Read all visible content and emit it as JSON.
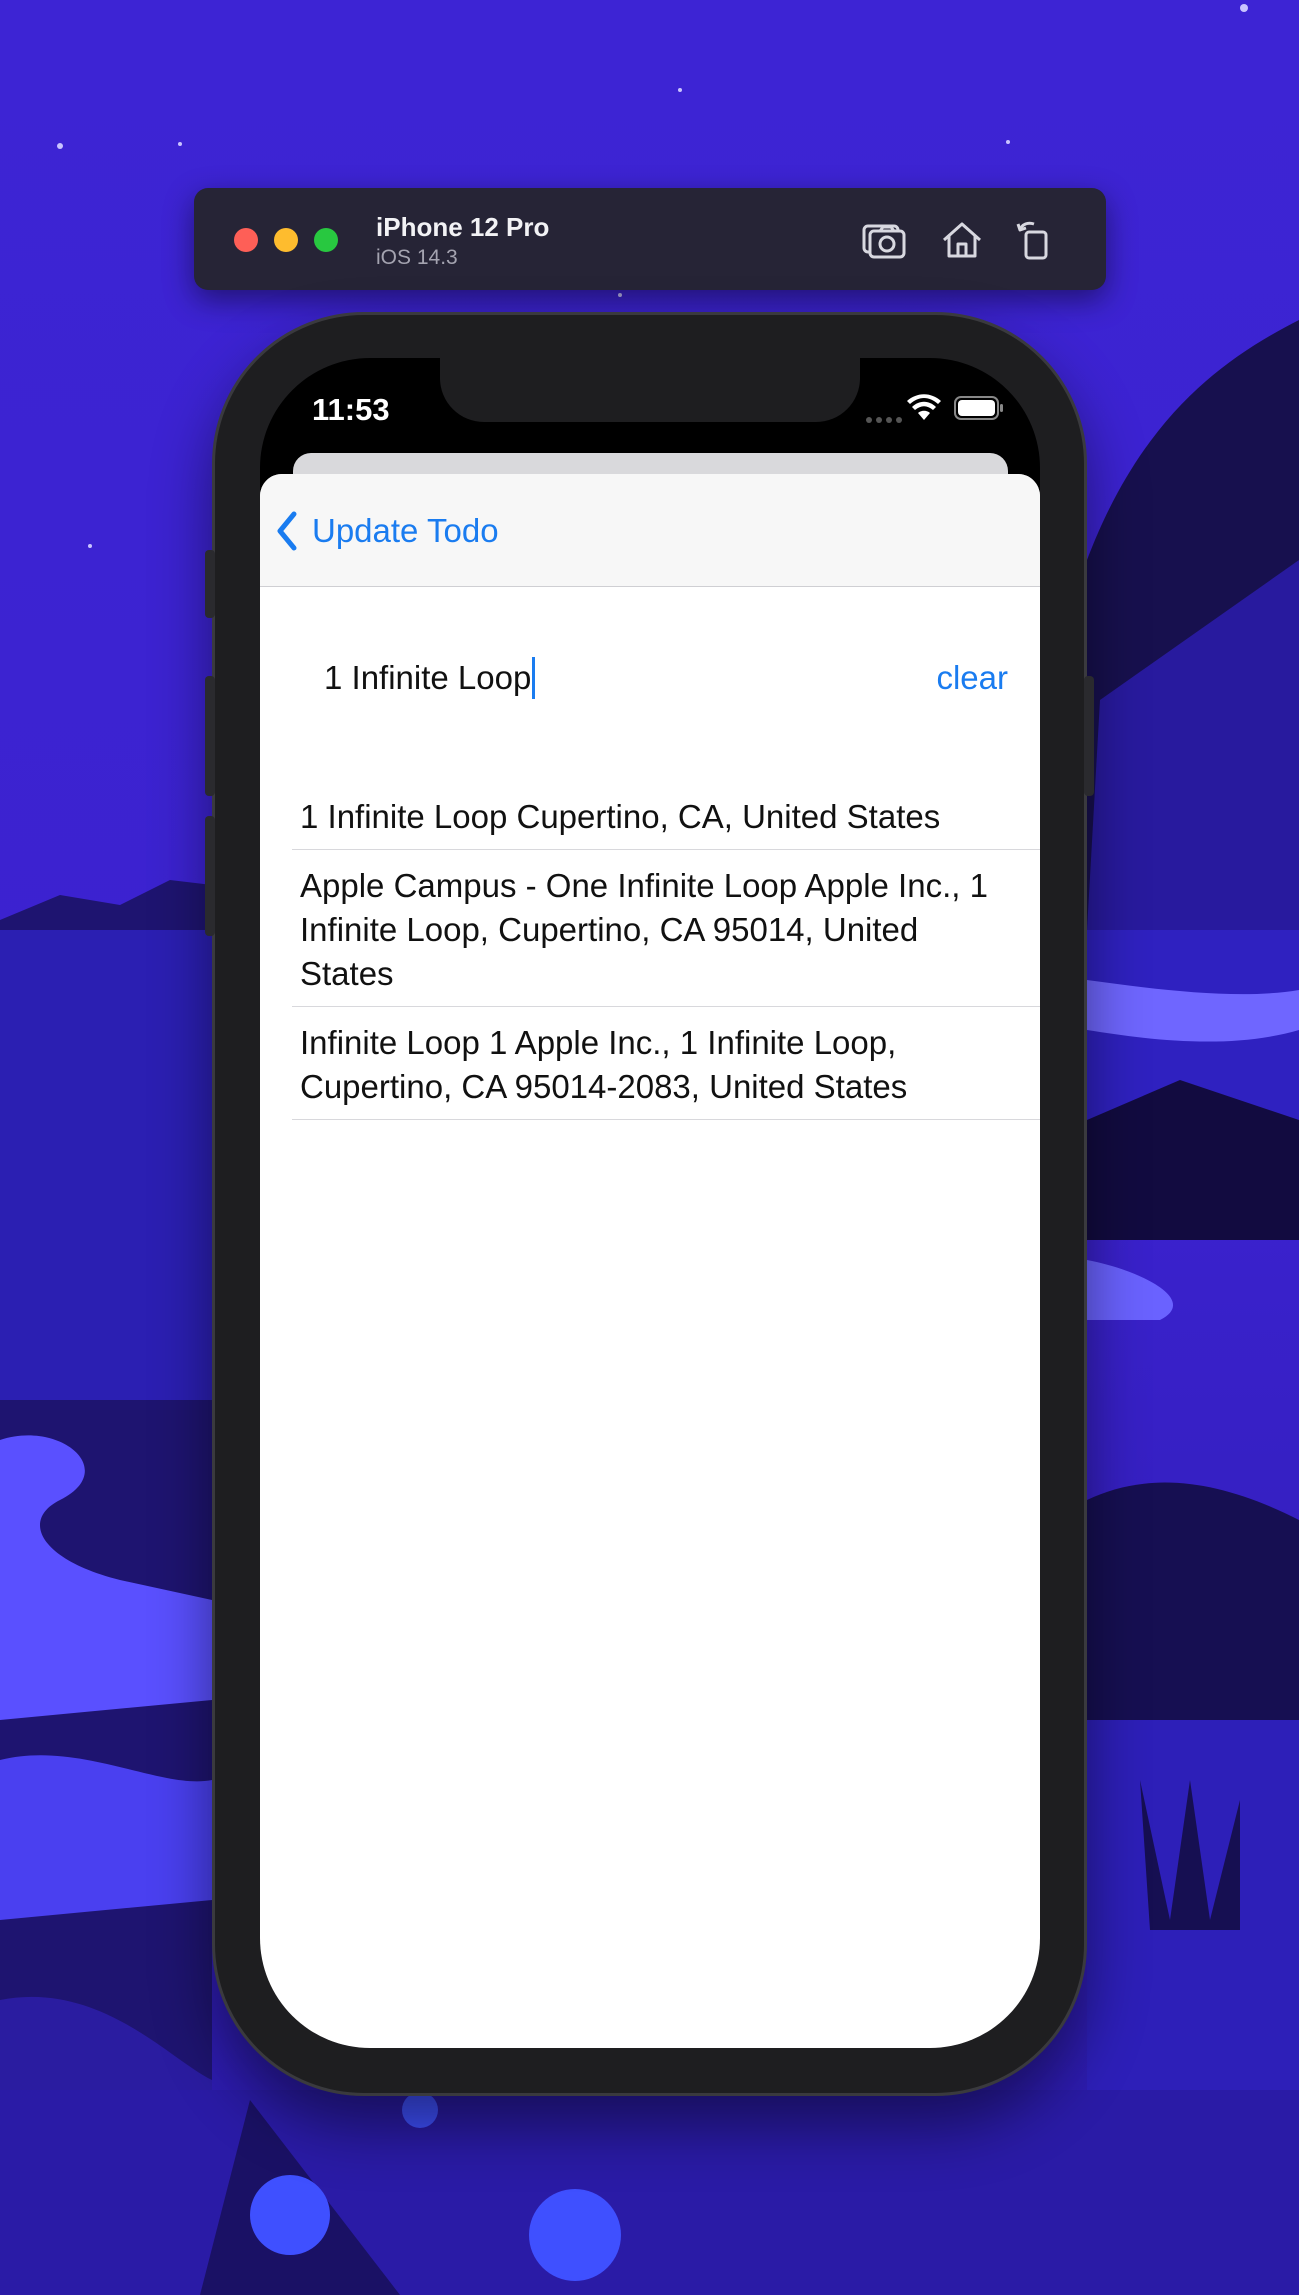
{
  "simulator": {
    "device_name": "iPhone 12 Pro",
    "os_version": "iOS 14.3",
    "buttons": [
      "screenshot-icon",
      "home-icon",
      "rotate-icon"
    ]
  },
  "status_bar": {
    "time": "11:53"
  },
  "nav": {
    "back_label": "Update Todo"
  },
  "search": {
    "value": "1 Infinite Loop",
    "clear_label": "clear"
  },
  "results": [
    "1 Infinite Loop Cupertino, CA, United States",
    "Apple Campus - One Infinite Loop Apple Inc., 1 Infinite Loop, Cupertino, CA 95014, United States",
    "Infinite Loop 1 Apple Inc., 1 Infinite Loop, Cupertino, CA  95014-2083, United States"
  ],
  "colors": {
    "accent": "#1a7cf0",
    "wallpaper": "#3a24d6"
  }
}
